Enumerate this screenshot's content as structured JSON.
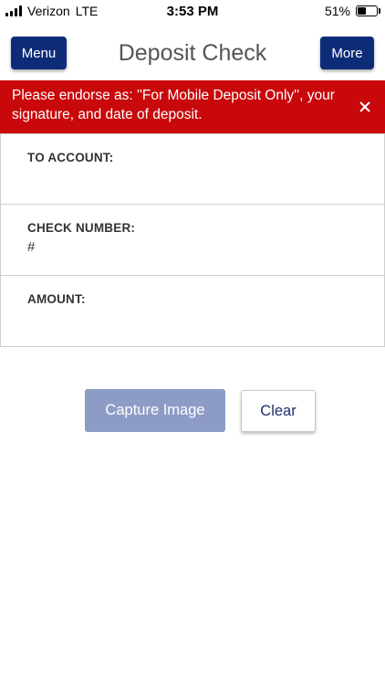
{
  "status_bar": {
    "carrier": "Verizon",
    "network": "LTE",
    "time": "3:53 PM",
    "battery_text": "51%",
    "battery_level": 0.51
  },
  "header": {
    "menu_label": "Menu",
    "title": "Deposit Check",
    "more_label": "More"
  },
  "alert": {
    "message": "Please endorse as: ''For Mobile Deposit Only'', your signature, and date of deposit.",
    "background": "#c9080b"
  },
  "fields": [
    {
      "label": "TO ACCOUNT:",
      "value": ""
    },
    {
      "label": "CHECK NUMBER:",
      "value": "#"
    },
    {
      "label": "AMOUNT:",
      "value": ""
    }
  ],
  "actions": {
    "capture_label": "Capture Image",
    "clear_label": "Clear"
  },
  "colors": {
    "brand": "#0d2c78",
    "capture_disabled": "#8d9cc6",
    "clear_text": "#1d2d6a"
  }
}
